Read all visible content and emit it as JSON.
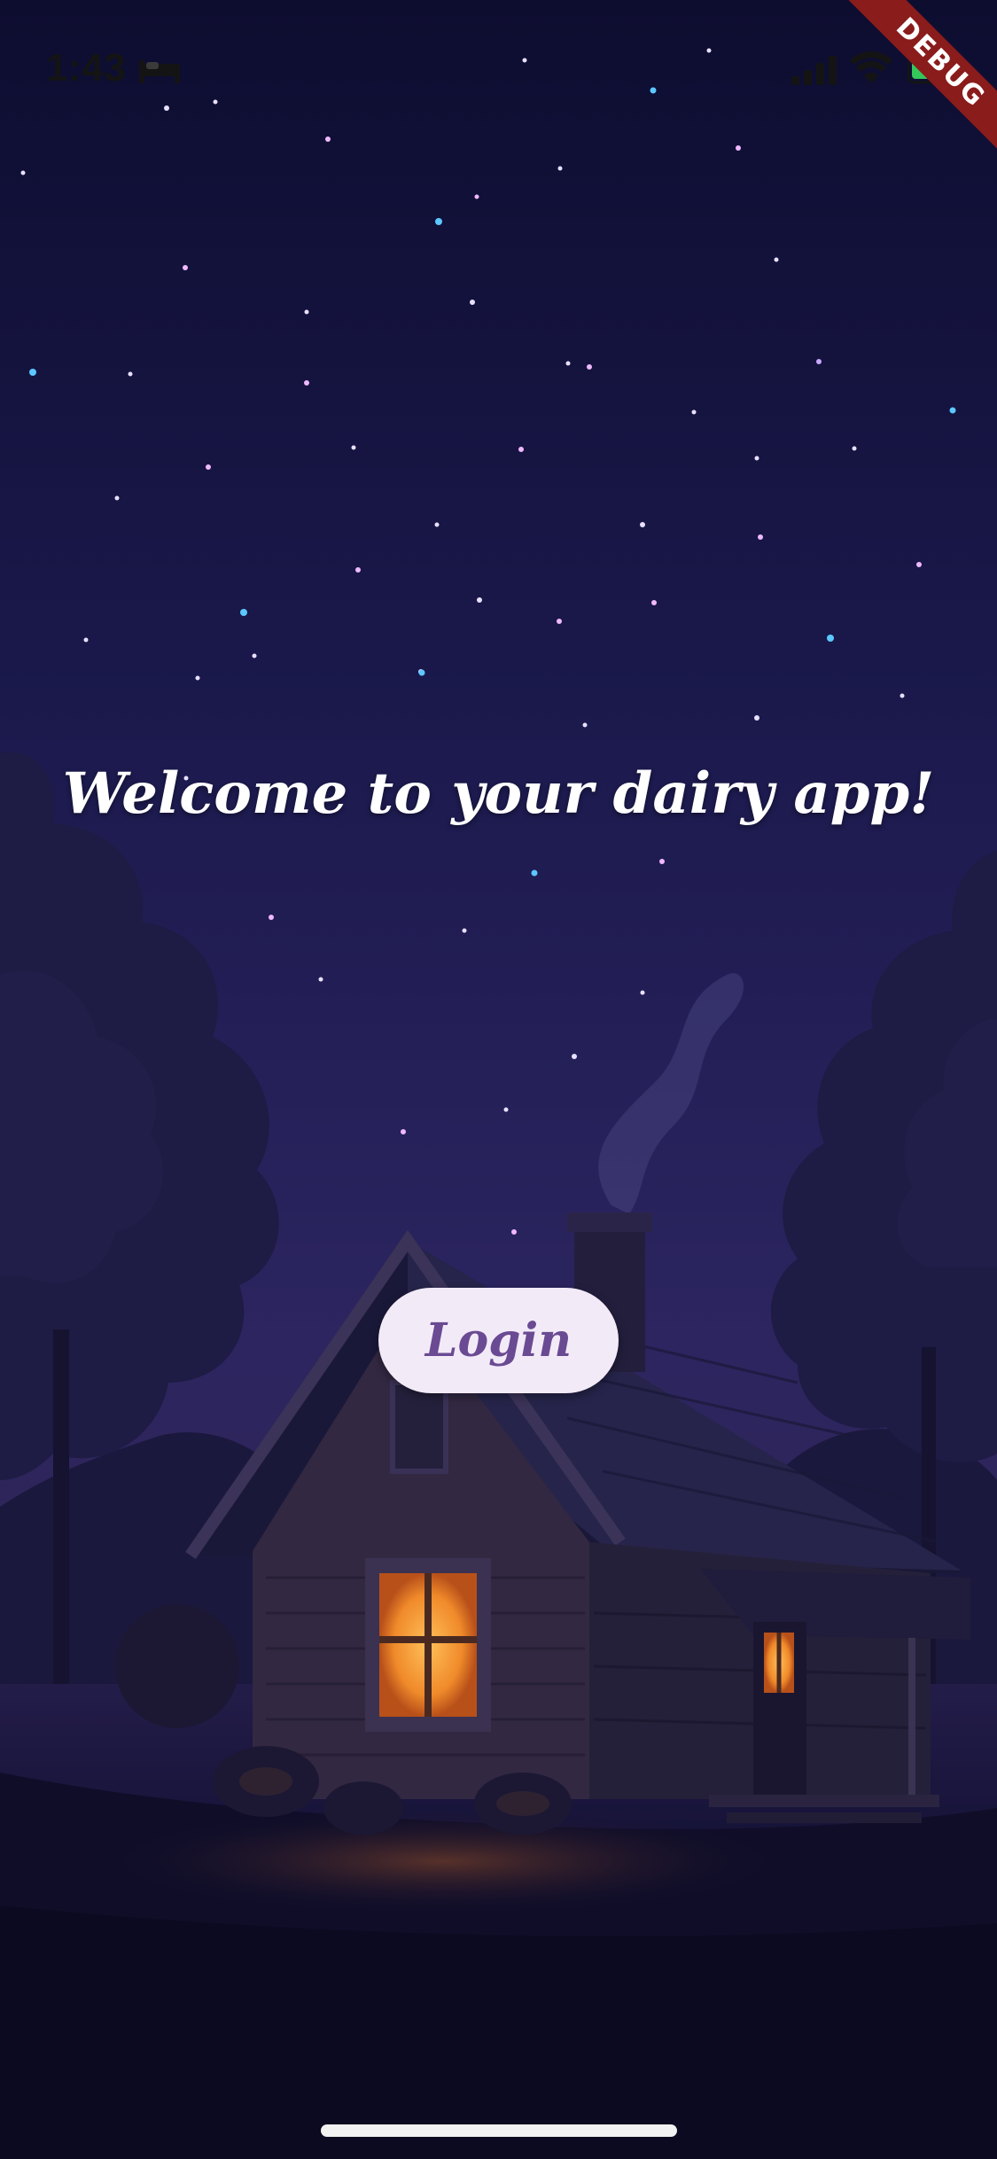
{
  "status_bar": {
    "time": "1:43",
    "sleep_icon": "bed-icon",
    "signal_icon": "cellular-signal-icon",
    "wifi_icon": "wifi-icon",
    "battery_icon": "battery-charging-icon"
  },
  "debug_banner": {
    "label": "DEBUG",
    "color": "#8a1c1c"
  },
  "welcome": {
    "title": "Welcome to your dairy app!"
  },
  "login": {
    "label": "Login",
    "background": "#f3eaf8",
    "text_color": "#6a4a92"
  },
  "background": {
    "description_icon": "night-cabin-illustration",
    "sky_color": "#1b1a4a",
    "window_glow": "#f3a23a"
  }
}
